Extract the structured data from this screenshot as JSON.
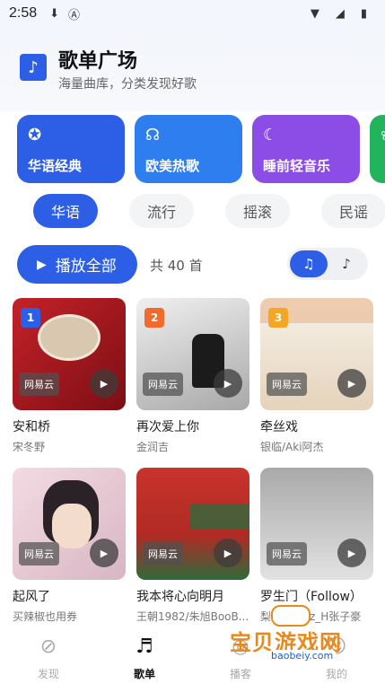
{
  "status_bar": {
    "time": "2:58",
    "icons": [
      "download-icon",
      "a-icon",
      "wifi-icon",
      "signal-icon",
      "battery-icon"
    ]
  },
  "header": {
    "title": "歌单广场",
    "subtitle": "海量曲库，分类发现好歌"
  },
  "categories": [
    {
      "label": "华语经典",
      "icon": "badge-icon",
      "color": "#2d5fe6"
    },
    {
      "label": "欧美热歌",
      "icon": "headphones-icon",
      "color": "#2f7ef0"
    },
    {
      "label": "睡前轻音乐",
      "icon": "moon-icon",
      "color": "#8c4de6"
    },
    {
      "label": "",
      "icon": "leaf-icon",
      "color": "#22b45c"
    }
  ],
  "filters": {
    "items": [
      "华语",
      "流行",
      "摇滚",
      "民谣"
    ],
    "active": "华语"
  },
  "toolbar": {
    "play_all": "播放全部",
    "count": "共 40 首"
  },
  "playlists": [
    {
      "rank": "1",
      "rank_color": "#2d5fe6",
      "title": "安和桥",
      "artist": "宋冬野",
      "source": "网易云",
      "cover": [
        "#b81f24",
        "#8a1218"
      ]
    },
    {
      "rank": "2",
      "rank_color": "#f26a2e",
      "title": "再次爱上你",
      "artist": "金润吉",
      "source": "网易云",
      "cover": [
        "#e8e8e8",
        "#9a9a9a"
      ]
    },
    {
      "rank": "3",
      "rank_color": "#f5a623",
      "title": "牵丝戏",
      "artist": "银临/Aki阿杰",
      "source": "网易云",
      "cover": [
        "#f6f1e8",
        "#d9c3a5"
      ]
    },
    {
      "rank": "",
      "rank_color": "",
      "title": "起风了",
      "artist": "买辣椒也用券",
      "source": "网易云",
      "cover": [
        "#e9c9d4",
        "#c8a8b8"
      ]
    },
    {
      "rank": "",
      "rank_color": "",
      "title": "我本将心向明月",
      "artist": "王朝1982/朱旭BooB...",
      "source": "网易云",
      "cover": [
        "#c8342c",
        "#2f6a3c"
      ]
    },
    {
      "rank": "",
      "rank_color": "",
      "title": "罗生门（Follow）",
      "artist": "梨冻紧/Wiz_H张子豪",
      "source": "网易云",
      "cover": [
        "#b9b9b9",
        "#dcdcdc"
      ]
    }
  ],
  "tabbar": [
    {
      "label": "发现",
      "icon": "compass-icon",
      "active": false
    },
    {
      "label": "歌单",
      "icon": "playlist-icon",
      "active": true
    },
    {
      "label": "播客",
      "icon": "podcast-icon",
      "active": false
    },
    {
      "label": "我的",
      "icon": "user-icon",
      "active": false
    }
  ],
  "watermark": {
    "title": "宝贝游戏网",
    "url": "baobeiy.com"
  }
}
